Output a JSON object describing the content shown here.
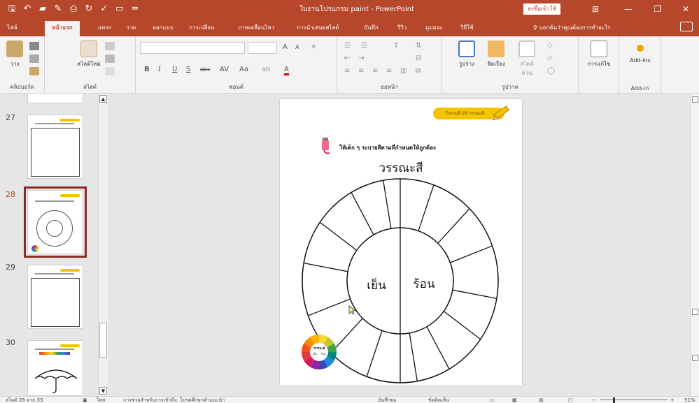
{
  "window": {
    "title": "ใบงานโปรแกรม paint - PowerPoint",
    "sign_in": "ลงชื่อเข้าใช้",
    "colors": {
      "brand": "#b7472a",
      "ribbon": "#f3f3f3",
      "selected_thumb": "#8a2c24"
    }
  },
  "tabs": [
    "ไฟล์",
    "หน้าแรก",
    "แทรก",
    "วาด",
    "ออกแบบ",
    "การเปลี่ยน",
    "ภาพเคลื่อนไหว",
    "การนำเสนอสไลด์",
    "บันทึก",
    "รีวิว",
    "มุมมอง",
    "วิธีใช้"
  ],
  "active_tab": "หน้าแรก",
  "tell_me": "บอกฉันว่าคุณต้องการทำอะไร",
  "ribbon": {
    "clipboard": {
      "paste": "วาง",
      "label": "คลิปบอร์ด"
    },
    "slides": {
      "new_slide": "สไลด์ใหม่",
      "label": "สไลด์"
    },
    "font": {
      "bold": "B",
      "italic": "I",
      "underline": "U",
      "strike": "S",
      "spacing": "abc",
      "case": "Aa",
      "grow": "A",
      "shrink": "A",
      "label": "ฟอนต์"
    },
    "paragraph": {
      "label": "ย่อหน้า"
    },
    "drawing": {
      "shapes": "รูปร่าง",
      "arrange": "จัดเรียง",
      "quick_styles": "สไตล์ด่วน",
      "label": "รูปวาด"
    },
    "editing": {
      "find": "การแก้ไข"
    },
    "addins": {
      "button": "Add-ins",
      "label": "Add-in"
    }
  },
  "slides_panel": {
    "items": [
      {
        "number": "27"
      },
      {
        "number": "28",
        "selected": true
      },
      {
        "number": "29"
      },
      {
        "number": "30"
      }
    ]
  },
  "slide": {
    "badge": "ใบงานที่ 18 วรรณะสี",
    "instruction": "ให้เด็ก ๆ ระบายสีตามที่กำหนดให้ถูกต้อง",
    "title": "วรรณะสี",
    "cool_label": "เย็น",
    "warm_label": "ร้อน",
    "mini_wheel": {
      "title": "วรรณะสี",
      "cool": "เย็น",
      "warm": "ร้อน"
    }
  },
  "status": {
    "slide_info": "สไลด์ 28 จาก 33",
    "language": "ไทย",
    "accessibility": "การช่วยสำหรับการเข้าถึง: โปรดศึกษาคำแนะนำ",
    "notes": "บันทึกย่อ",
    "comments": "ข้อคิดเห็น",
    "zoom": "51%"
  }
}
